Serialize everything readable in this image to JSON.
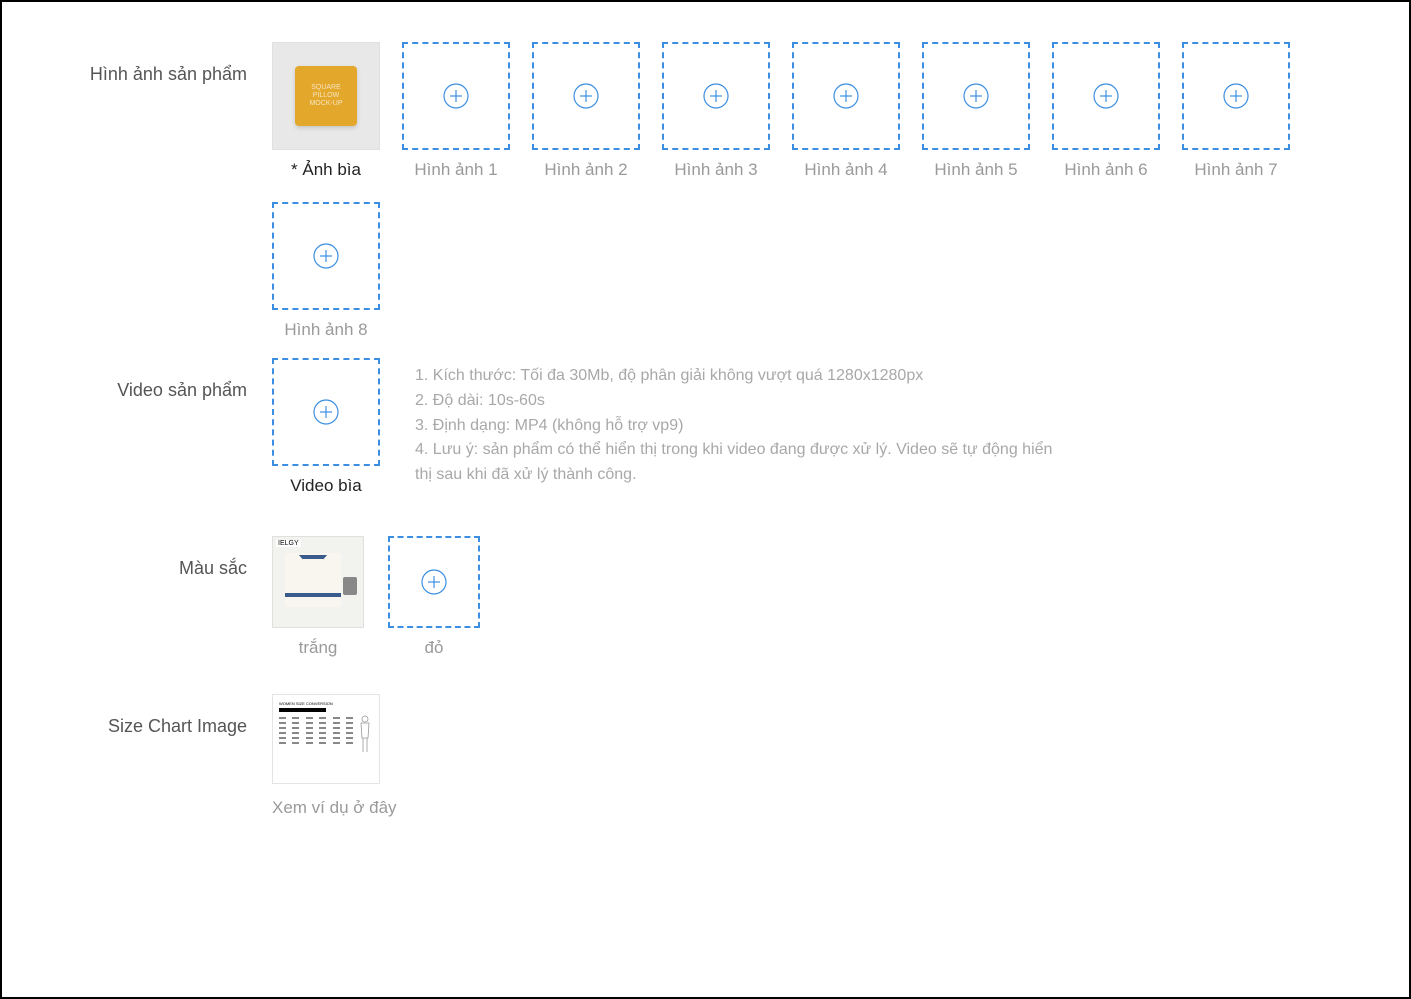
{
  "sections": {
    "product_images": {
      "label": "Hình ảnh sản phẩm",
      "cover_caption": "Ảnh bìa",
      "slot_captions": [
        "Hình ảnh 1",
        "Hình ảnh 2",
        "Hình ảnh 3",
        "Hình ảnh 4",
        "Hình ảnh 5",
        "Hình ảnh 6",
        "Hình ảnh 7",
        "Hình ảnh 8"
      ]
    },
    "product_video": {
      "label": "Video sản phẩm",
      "caption": "Video bìa",
      "hints": [
        "1. Kích thước: Tối đa 30Mb, độ phân giải không vượt quá 1280x1280px",
        "2. Độ dài: 10s-60s",
        "3. Định dạng: MP4 (không hỗ trợ vp9)",
        "4. Lưu ý: sản phẩm có thể hiển thị trong khi video đang được xử lý. Video sẽ tự động hiển thị sau khi đã xử lý thành công."
      ]
    },
    "colors": {
      "label": "Màu sắc",
      "items": [
        {
          "name": "trắng",
          "has_image": true
        },
        {
          "name": "đỏ",
          "has_image": false
        }
      ]
    },
    "size_chart": {
      "label": "Size Chart Image",
      "link_text": "Xem ví dụ ở đây"
    }
  }
}
